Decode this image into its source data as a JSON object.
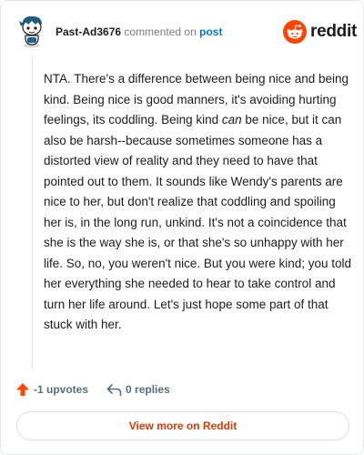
{
  "header": {
    "username": "Past-Ad3676",
    "action": "commented on",
    "post_link": "post",
    "logo_word": "reddit",
    "avatar_icon": "snoo-avatar-icon",
    "logo_icon": "reddit-snoo-icon"
  },
  "comment": {
    "part1": "NTA. There's a difference between being nice and being kind. Being nice is good manners, it's avoiding hurting feelings, its coddling. Being kind ",
    "emphasis": "can",
    "part2": " be nice, but it can also be harsh--because sometimes someone has a distorted view of reality and they need to have that pointed out to them. It sounds like Wendy's parents are nice to her, but don't realize that coddling and spoiling her is, in the long run, unkind. It's not a coincidence that she is the way she is, or that she's so unhappy with her life. So, no, you weren't nice. But you were kind; you told her everything she needed to hear to take control and turn her life around. Let's just hope some part of that stuck with her."
  },
  "footer": {
    "upvotes": "-1 upvotes",
    "replies": "0 replies",
    "upvote_icon": "upvote-arrow-icon",
    "reply_icon": "reply-arrow-icon"
  },
  "cta": {
    "label": "View more on Reddit"
  },
  "colors": {
    "accent": "#d93a00",
    "link": "#0079d3",
    "upvote": "#ff4500"
  }
}
